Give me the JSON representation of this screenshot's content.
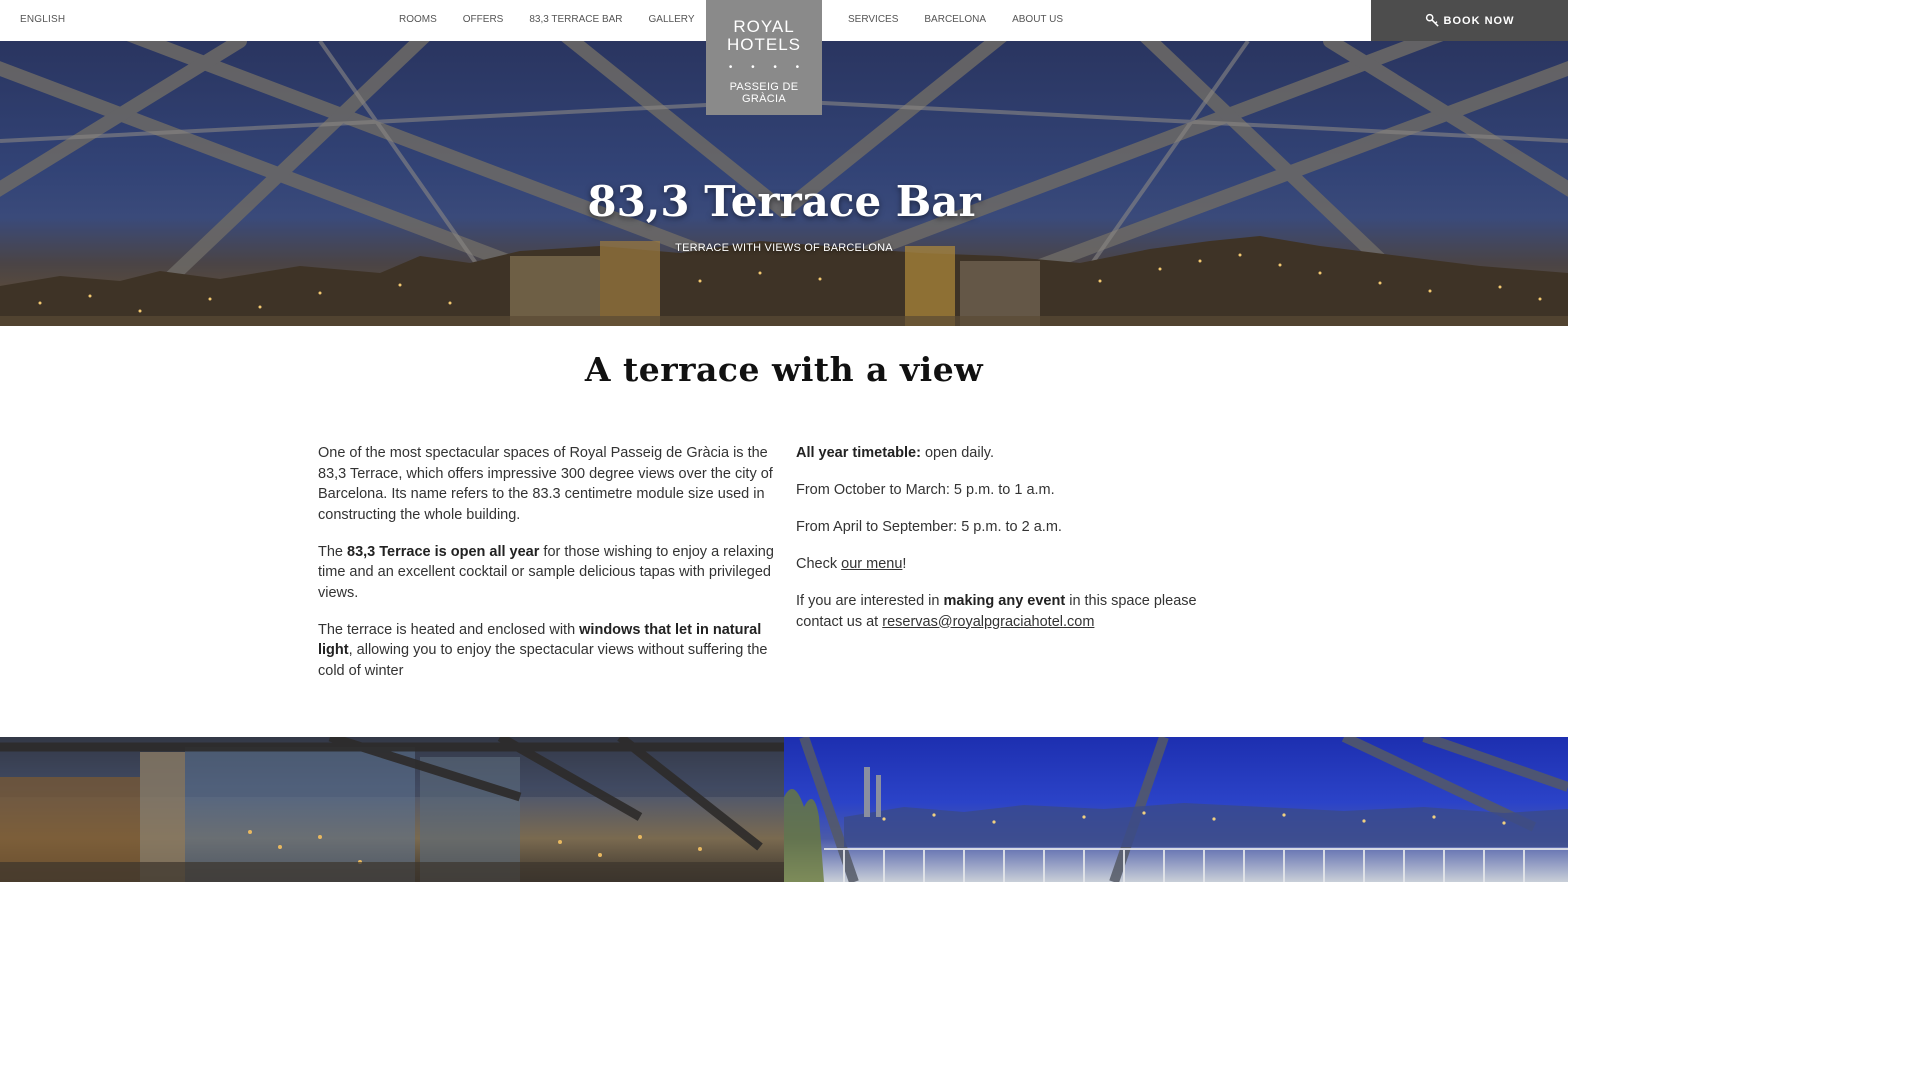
{
  "header": {
    "language": "ENGLISH",
    "nav_left": [
      "ROOMS",
      "OFFERS",
      "83,3 TERRACE BAR",
      "GALLERY"
    ],
    "nav_right": [
      "SERVICES",
      "BARCELONA",
      "ABOUT US"
    ],
    "logo": {
      "line1": "ROYAL",
      "line2": "HOTELS",
      "dots": "• • • •",
      "line3": "PASSEIG DE",
      "line4": "GRÀCIA"
    },
    "book_label": "BOOK NOW",
    "book_icon": "key-icon"
  },
  "hero": {
    "title": "83,3 Terrace Bar",
    "subtitle": "TERRACE WITH VIEWS OF BARCELONA"
  },
  "main": {
    "title": "A terrace with a view",
    "left": {
      "p1": "One of the most spectacular spaces of Royal Passeig de Gràcia is the 83,3 Terrace, which offers impressive 300 degree views over the city of Barcelona. Its name refers to the 83.3 centimetre module size used in constructing the whole building.",
      "p2_pre": "The ",
      "p2_bold": "83,3 Terrace is open all year",
      "p2_post": " for those wishing to enjoy a relaxing time and an excellent cocktail or sample delicious tapas with privileged views.",
      "p3_pre": "The terrace is heated and enclosed with ",
      "p3_bold": "windows that let in natural light",
      "p3_post": ", allowing you to enjoy the spectacular views without suffering the cold of winter"
    },
    "right": {
      "timetable_label": "All year timetable:",
      "timetable_value": " open daily.",
      "winter": "From October to March: 5 p.m. to 1 a.m.",
      "summer": "From April to September:  5 p.m. to 2 a.m.",
      "menu_pre": "Check ",
      "menu_link": "our menu",
      "menu_post": "!",
      "event_pre": "If you are interested in ",
      "event_bold": "making any event",
      "event_post": " in this space please contact us at ",
      "email": "reservas@royalpgraciahotel.com"
    }
  },
  "colors": {
    "logo_bg": "#8a8a8a",
    "book_bg": "#4d4d4d",
    "logo_accent": "#3fa9f5"
  }
}
